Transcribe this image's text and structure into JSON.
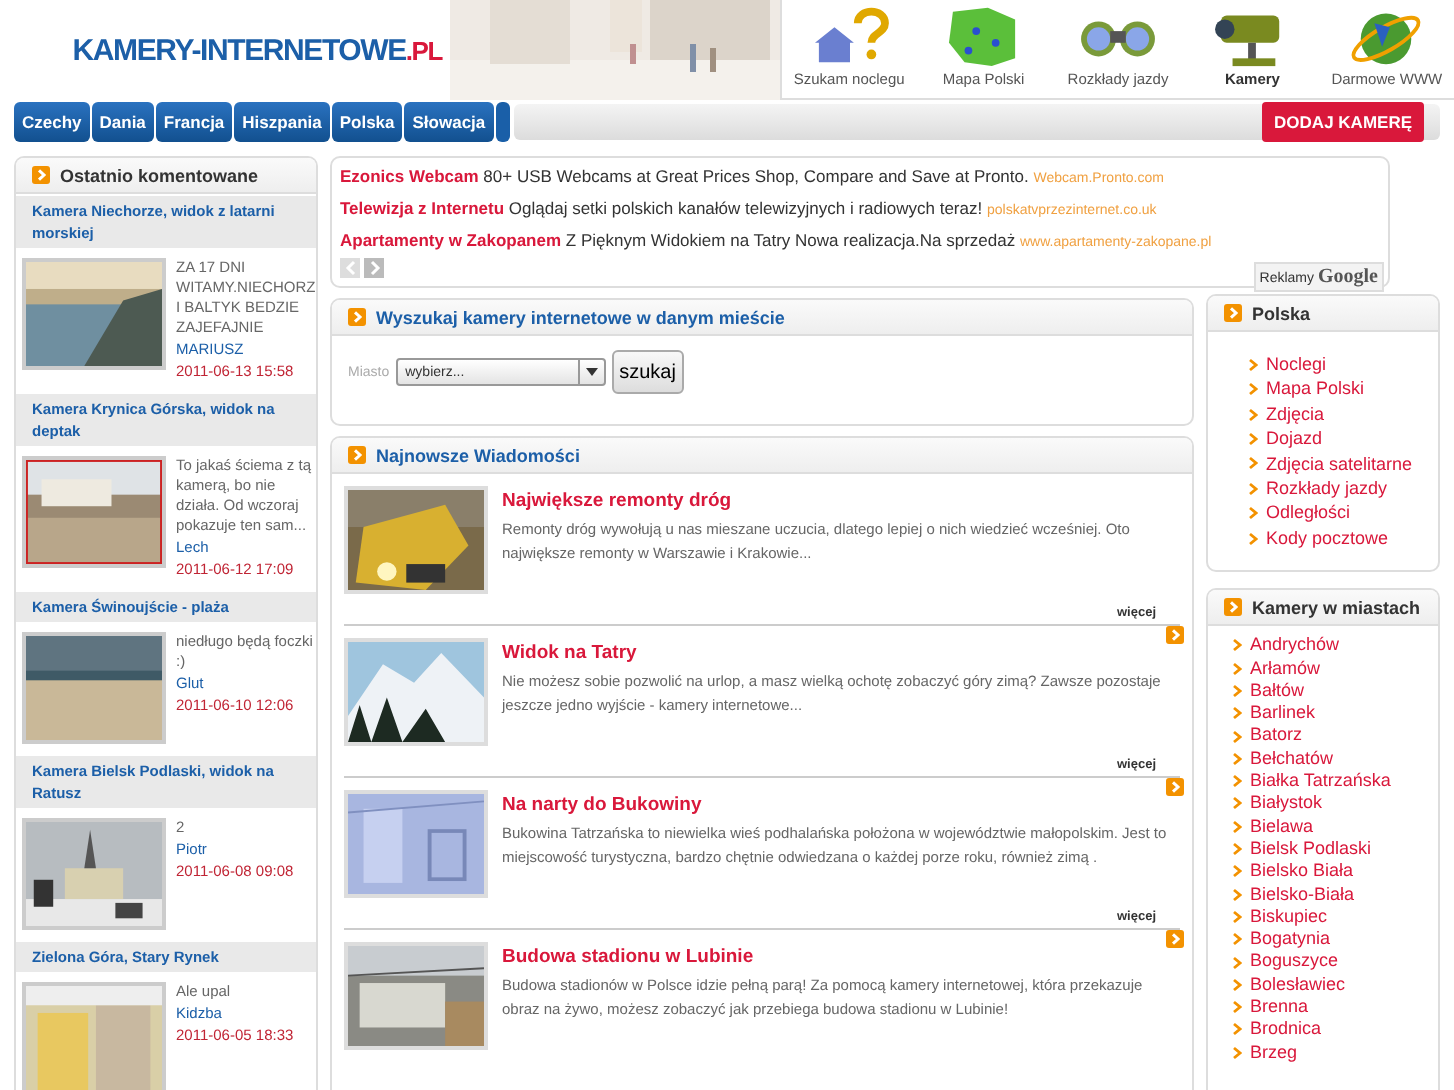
{
  "logo": {
    "text": "KAMERY-INTERNETOWE",
    "suffix": ".PL"
  },
  "top_nav": [
    {
      "label": "Szukam noclegu",
      "selected": false
    },
    {
      "label": "Mapa Polski",
      "selected": false
    },
    {
      "label": "Rozkłady jazdy",
      "selected": false
    },
    {
      "label": "Kamery",
      "selected": true
    },
    {
      "label": "Darmowe WWW",
      "selected": false
    }
  ],
  "countries": [
    "Czechy",
    "Dania",
    "Francja",
    "Hiszpania",
    "Polska",
    "Słowacja"
  ],
  "add_camera_button": "DODAJ KAMERĘ",
  "recent_comments": {
    "title": "Ostatnio komentowane",
    "items": [
      {
        "camera": "Kamera Niechorze, widok z latarni morskiej",
        "comment": "ZA 17 DNI WITAMY.NIECHORZ I BALTYK BEDZIE ZAJEFAJNIE",
        "author": "MARIUSZ",
        "date": "2011-06-13 15:58"
      },
      {
        "camera": "Kamera Krynica Górska, widok na deptak",
        "comment": "To jakaś ściema z tą kamerą, bo nie działa. Od wczoraj pokazuje ten sam...",
        "author": "Lech",
        "date": "2011-06-12 17:09"
      },
      {
        "camera": "Kamera Świnoujście - plaża",
        "comment": "niedługo będą foczki :)",
        "author": "Glut",
        "date": "2011-06-10 12:06"
      },
      {
        "camera": "Kamera Bielsk Podlaski, widok na Ratusz",
        "comment": "2",
        "author": "Piotr",
        "date": "2011-06-08 09:08"
      },
      {
        "camera": "Zielona Góra, Stary Rynek",
        "comment": "Ale upal",
        "author": "Kidzba",
        "date": "2011-06-05 18:33"
      }
    ]
  },
  "ads": [
    {
      "title": "Ezonics Webcam",
      "text": "80+ USB Webcams at Great Prices Shop, Compare and Save at Pronto.",
      "url": "Webcam.Pronto.com"
    },
    {
      "title": "Telewizja z Internetu",
      "text": "Oglądaj setki polskich kanałów telewizyjnych i radiowych teraz!",
      "url": "polskatvprzezinternet.co.uk"
    },
    {
      "title": "Apartamenty w Zakopanem",
      "text": "Z Pięknym Widokiem na Tatry Nowa realizacja.Na sprzedaż",
      "url": "www.apartamenty-zakopane.pl"
    }
  ],
  "ads_label": {
    "text": "Reklamy",
    "brand": "Google"
  },
  "search": {
    "title": "Wyszukaj kamery internetowe w danym mieście",
    "label": "Miasto",
    "value": "wybierz...",
    "button": "szukaj"
  },
  "news": {
    "title": "Najnowsze Wiadomości",
    "items": [
      {
        "title": "Największe remonty dróg",
        "text": "Remonty dróg wywołują u nas mieszane uczucia, dlatego lepiej o nich wiedzieć wcześniej. Oto największe remonty w Warszawie i Krakowie...",
        "more": "więcej"
      },
      {
        "title": "Widok na Tatry",
        "text": "Nie możesz sobie pozwolić na urlop, a masz wielką ochotę zobaczyć góry zimą? Zawsze pozostaje jeszcze jedno wyjście - kamery internetowe...",
        "more": "więcej"
      },
      {
        "title": "Na narty do Bukowiny",
        "text": "Bukowina Tatrzańska to niewielka wieś podhalańska położona w województwie małopolskim. Jest to miejscowość turystyczna, bardzo chętnie odwiedzana o każdej porze roku, również zimą .",
        "more": "więcej"
      },
      {
        "title": "Budowa stadionu w Lubinie",
        "text": "Budowa stadionów w Polsce idzie pełną parą! Za pomocą kamery internetowej, która przekazuje obraz na żywo, możesz zobaczyć jak przebiega budowa stadionu w Lubinie!"
      }
    ]
  },
  "poland_menu": {
    "title": "Polska",
    "items": [
      "Noclegi",
      "Mapa Polski",
      "Zdjęcia",
      "Dojazd",
      "Zdjęcia satelitarne",
      "Rozkłady jazdy",
      "Odległości",
      "Kody pocztowe"
    ]
  },
  "city_cameras": {
    "title": "Kamery w miastach",
    "items": [
      "Andrychów",
      "Arłamów",
      "Bałtów",
      "Barlinek",
      "Batorz",
      "Bełchatów",
      "Białka Tatrzańska",
      "Białystok",
      "Bielawa",
      "Bielsk Podlaski",
      "Bielsko Biała",
      "Bielsko-Biała",
      "Biskupiec",
      "Bogatynia",
      "Boguszyce",
      "Bolesławiec",
      "Brenna",
      "Brodnica",
      "Brzeg"
    ]
  }
}
